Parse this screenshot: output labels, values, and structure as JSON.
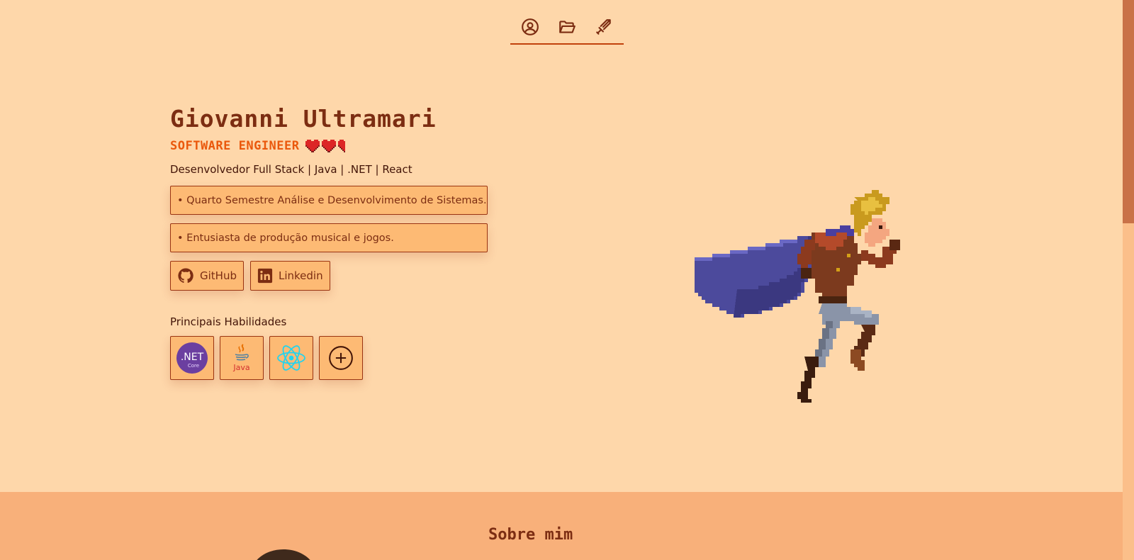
{
  "nav": {
    "items": [
      {
        "icon": "user-circle-icon",
        "target": "profile"
      },
      {
        "icon": "folder-open-icon",
        "target": "projects"
      },
      {
        "icon": "sword-icon",
        "target": "skills"
      }
    ]
  },
  "hero": {
    "name": "Giovanni Ultramari",
    "role": "SOFTWARE ENGINEER",
    "hearts": {
      "full": 2,
      "half": 1
    },
    "tagline": "Desenvolvedor Full Stack | Java | .NET | React",
    "cards": [
      "• Quarto Semestre Análise e Desenvolvimento de Sistemas.",
      "• Entusiasta de produção musical e jogos."
    ],
    "links": [
      {
        "label": "GitHub",
        "icon": "github-icon"
      },
      {
        "label": "Linkedin",
        "icon": "linkedin-icon"
      }
    ],
    "skills_title": "Principais Habilidades",
    "skills": [
      {
        "icon": "dotnet-core-icon",
        "text": ".NET",
        "subtext": "Core"
      },
      {
        "icon": "java-icon",
        "text": "Java"
      },
      {
        "icon": "react-icon"
      },
      {
        "icon": "plus-circle-icon"
      }
    ]
  },
  "about": {
    "title": "Sobre mim"
  },
  "colors": {
    "background": "#fed7aa",
    "accent": "#ea580c",
    "text": "#7c2d12",
    "card": "#fdba74",
    "about_bg": "#f8b07a"
  }
}
